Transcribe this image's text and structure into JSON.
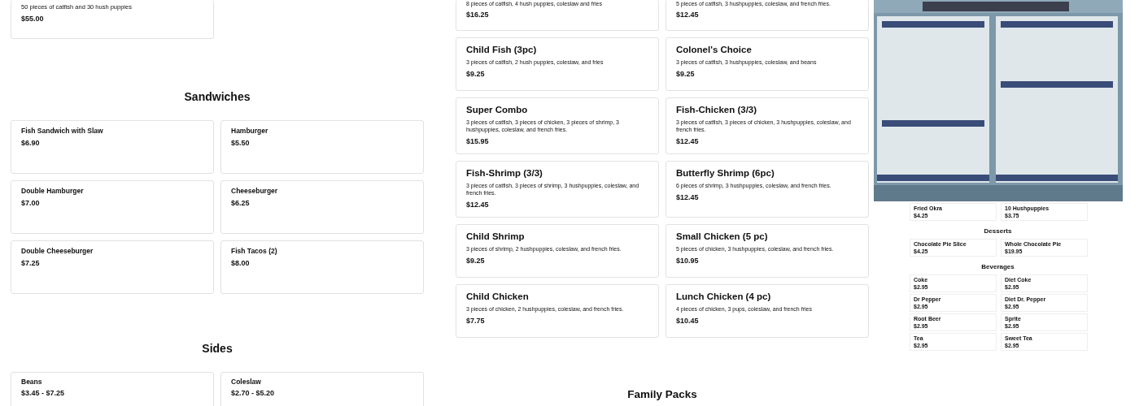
{
  "left": {
    "top_card": {
      "description": "50 pieces of catfish and 30 hush puppies",
      "price": "$55.00"
    },
    "sections": [
      {
        "heading": "Sandwiches",
        "items": [
          {
            "name": "Fish Sandwich with Slaw",
            "price": "$6.90"
          },
          {
            "name": "Hamburger",
            "price": "$5.50"
          },
          {
            "name": "Double Hamburger",
            "price": "$7.00"
          },
          {
            "name": "Cheeseburger",
            "price": "$6.25"
          },
          {
            "name": "Double Cheeseburger",
            "price": "$7.25"
          },
          {
            "name": "Fish Tacos (2)",
            "price": "$8.00"
          }
        ]
      },
      {
        "heading": "Sides",
        "items": [
          {
            "name": "Beans",
            "price": "$3.45 - $7.25"
          },
          {
            "name": "Coleslaw",
            "price": "$2.70 - $5.20"
          }
        ]
      }
    ]
  },
  "middle": {
    "top_cards": [
      {
        "description": "8 pieces of catfish, 4 hush puppies, coleslaw and fries",
        "price": "$16.25"
      },
      {
        "description": "5 pieces of catfish, 3 hushpuppies, coleslaw, and french fries.",
        "price": "$12.45"
      }
    ],
    "items": [
      {
        "name": "Child Fish (3pc)",
        "description": "3 pieces of catfish, 2 hush puppies, coleslaw, and fries",
        "price": "$9.25"
      },
      {
        "name": "Colonel's Choice",
        "description": "3 pieces of catfish, 3 hushpuppies, coleslaw, and beans",
        "price": "$9.25"
      },
      {
        "name": "Super Combo",
        "description": "3 pieces of catfish, 3 pieces of chicken, 3 pieces of shrimp, 3 hushpuppies, coleslaw, and french fries.",
        "price": "$15.95"
      },
      {
        "name": "Fish-Chicken (3/3)",
        "description": "3 pieces of catfish, 3 pieces of chicken, 3 hushpuppies, coleslaw, and french fries.",
        "price": "$12.45"
      },
      {
        "name": "Fish-Shrimp (3/3)",
        "description": "3 pieces of catfish, 3 pieces of shrimp, 3 hushpuppies, coleslaw, and french fries.",
        "price": "$12.45"
      },
      {
        "name": "Butterfly Shrimp (6pc)",
        "description": "6 pieces of shrimp, 3 hushpuppies, coleslaw, and french fries.",
        "price": "$12.45"
      },
      {
        "name": "Child Shrimp",
        "description": "3 pieces of shrimp, 2 hushpuppies, coleslaw, and french fries.",
        "price": "$9.25"
      },
      {
        "name": "Small Chicken (5 pc)",
        "description": "5 pieces of chicken, 3 hushpuppies, coleslaw, and french fries.",
        "price": "$10.95"
      },
      {
        "name": "Child Chicken",
        "description": "3 pieces of chicken, 2 hushpuppies, coleslaw, and french fries.",
        "price": "$7.75"
      },
      {
        "name": "Lunch Chicken (4 pc)",
        "description": "4 pieces of chicken, 3 pups, coleslaw, and french fries",
        "price": "$10.45"
      }
    ],
    "next_heading": "Family Packs"
  },
  "preview": {
    "top_items": [
      {
        "name": "Fried Okra",
        "price": "$4.25"
      },
      {
        "name": "10 Hushpuppies",
        "price": "$3.75"
      }
    ],
    "sections": [
      {
        "heading": "Desserts",
        "items": [
          {
            "name": "Chocolate Pie Slice",
            "price": "$4.25"
          },
          {
            "name": "Whole Chocolate Pie",
            "price": "$19.95"
          }
        ]
      },
      {
        "heading": "Beverages",
        "items": [
          {
            "name": "Coke",
            "price": "$2.95"
          },
          {
            "name": "Diet Coke",
            "price": "$2.95"
          },
          {
            "name": "Dr Pepper",
            "price": "$2.95"
          },
          {
            "name": "Diet Dr. Pepper",
            "price": "$2.95"
          },
          {
            "name": "Root Beer",
            "price": "$2.95"
          },
          {
            "name": "Sprite",
            "price": "$2.95"
          },
          {
            "name": "Tea",
            "price": "$2.95"
          },
          {
            "name": "Sweet Tea",
            "price": "$2.95"
          }
        ]
      }
    ]
  }
}
